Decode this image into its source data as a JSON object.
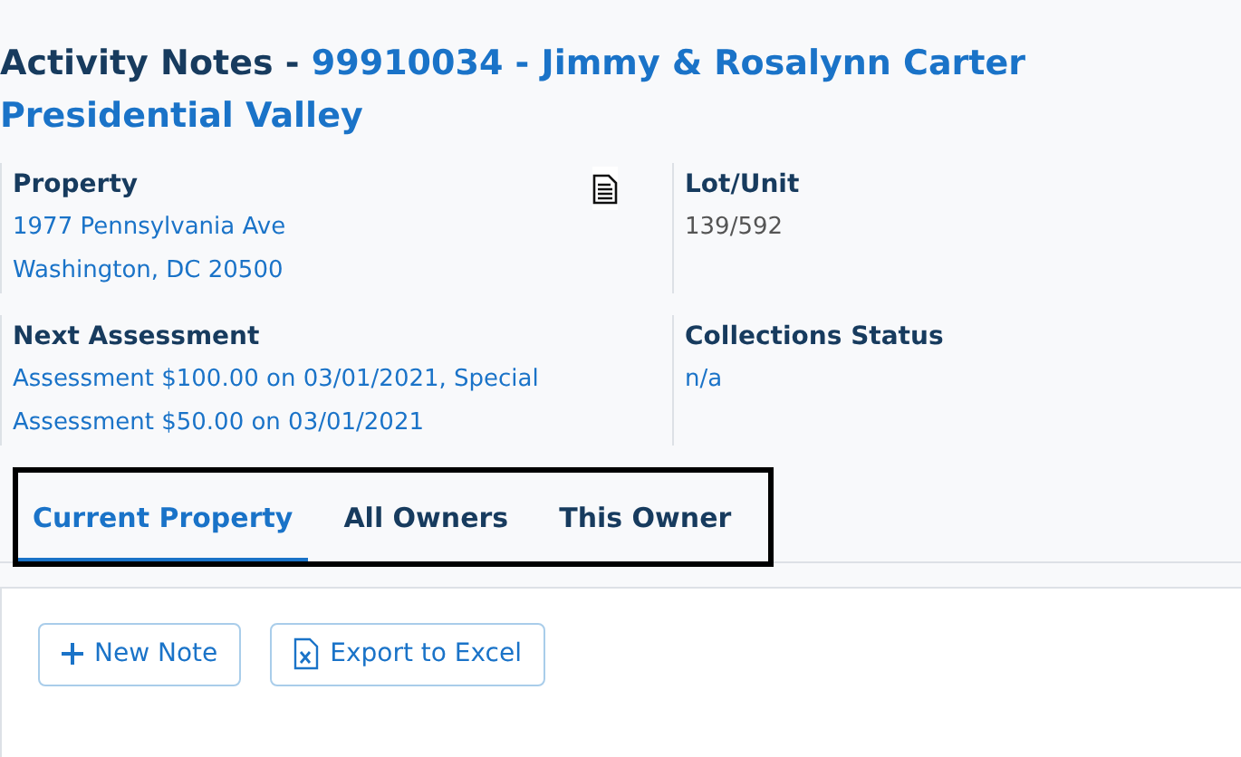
{
  "title": {
    "label": "Activity Notes -",
    "account": "99910034 - Jimmy & Rosalynn Carter",
    "community": "Presidential Valley"
  },
  "fields": [
    {
      "label": "Property",
      "lines": [
        "1977 Pennsylvania Ave",
        "Washington, DC 20500"
      ],
      "link": true,
      "has_document": true
    },
    {
      "label": "Lot/Unit",
      "lines": [
        "139/592"
      ],
      "link": false,
      "has_document": false
    },
    {
      "label": "Next Assessment",
      "lines": [
        "Assessment $100.00 on 03/01/2021, Special Assessment $50.00 on 03/01/2021"
      ],
      "link": true,
      "has_document": false
    },
    {
      "label": "Collections Status",
      "lines": [
        "n/a"
      ],
      "link": true,
      "has_document": false
    }
  ],
  "tabs": [
    {
      "label": "Current Property",
      "selected": true
    },
    {
      "label": "All Owners",
      "selected": false
    },
    {
      "label": "This Owner",
      "selected": false
    }
  ],
  "buttons": [
    {
      "label": "New Note",
      "kind": "add"
    },
    {
      "label": "Export to Excel",
      "kind": "excel"
    }
  ]
}
